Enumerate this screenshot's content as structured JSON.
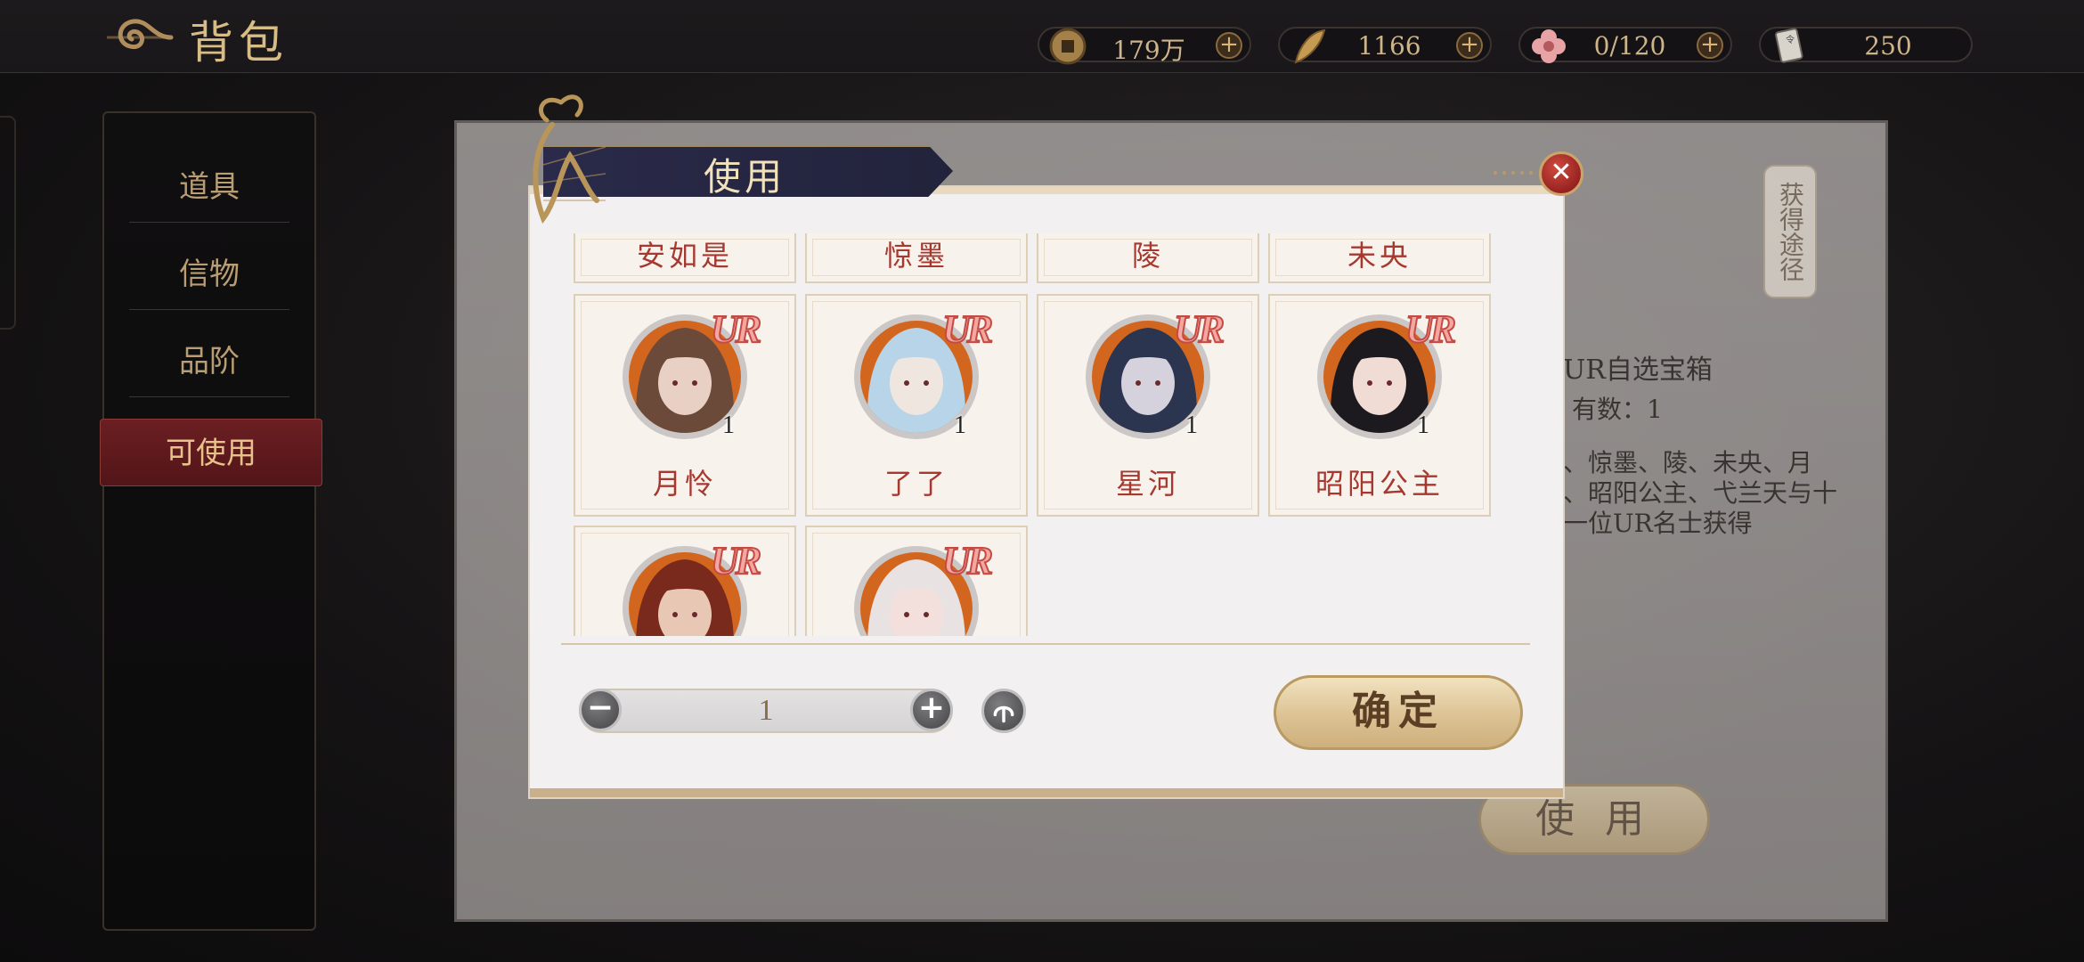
{
  "header": {
    "title": "背包",
    "currencies": [
      {
        "icon": "copper-coin-icon",
        "value": "179万"
      },
      {
        "icon": "feather-icon",
        "value": "1166"
      },
      {
        "icon": "flower-icon",
        "value": "0/120"
      },
      {
        "icon": "card-ticket-icon",
        "value": "250"
      }
    ]
  },
  "sidebar": {
    "items": [
      {
        "label": "道具",
        "active": false
      },
      {
        "label": "信物",
        "active": false
      },
      {
        "label": "品阶",
        "active": false
      },
      {
        "label": "可使用",
        "active": true
      }
    ]
  },
  "background_panel": {
    "item_name": "UR自选宝箱",
    "owned": "有数：1",
    "desc_line1": "、惊墨、陵、未央、月",
    "desc_line2": "、昭阳公主、弋兰天与十",
    "desc_line3": "一位UR名士获得",
    "obtain_label": "获得途径",
    "use_label": "使 用"
  },
  "modal": {
    "title": "使用",
    "close_icon": "close-icon",
    "top_row": [
      "安如是",
      "惊墨",
      "陵",
      "未央"
    ],
    "characters": [
      {
        "name": "月怜",
        "rarity": "UR",
        "qty": "1",
        "colors": [
          "#6b4a3a",
          "#e9d0c4"
        ]
      },
      {
        "name": "了了",
        "rarity": "UR",
        "qty": "1",
        "colors": [
          "#b8d4e8",
          "#f0e6e0"
        ]
      },
      {
        "name": "星河",
        "rarity": "UR",
        "qty": "1",
        "colors": [
          "#2c3550",
          "#d6d2dd"
        ]
      },
      {
        "name": "昭阳公主",
        "rarity": "UR",
        "qty": "1",
        "colors": [
          "#1c1a1e",
          "#f0dcd4"
        ]
      },
      {
        "name": "",
        "rarity": "UR",
        "qty": "",
        "colors": [
          "#7a2a1c",
          "#e8c8b4"
        ]
      },
      {
        "name": "",
        "rarity": "UR",
        "qty": "",
        "colors": [
          "#e8e2e2",
          "#f3e0dc"
        ]
      }
    ],
    "quantity": "1",
    "confirm_label": "确定"
  },
  "colors": {
    "accent_gold": "#d8bc86",
    "active_tab_red": "#6b1f22",
    "name_red": "#a6382f",
    "ur_pink": "#f4a7a0"
  }
}
